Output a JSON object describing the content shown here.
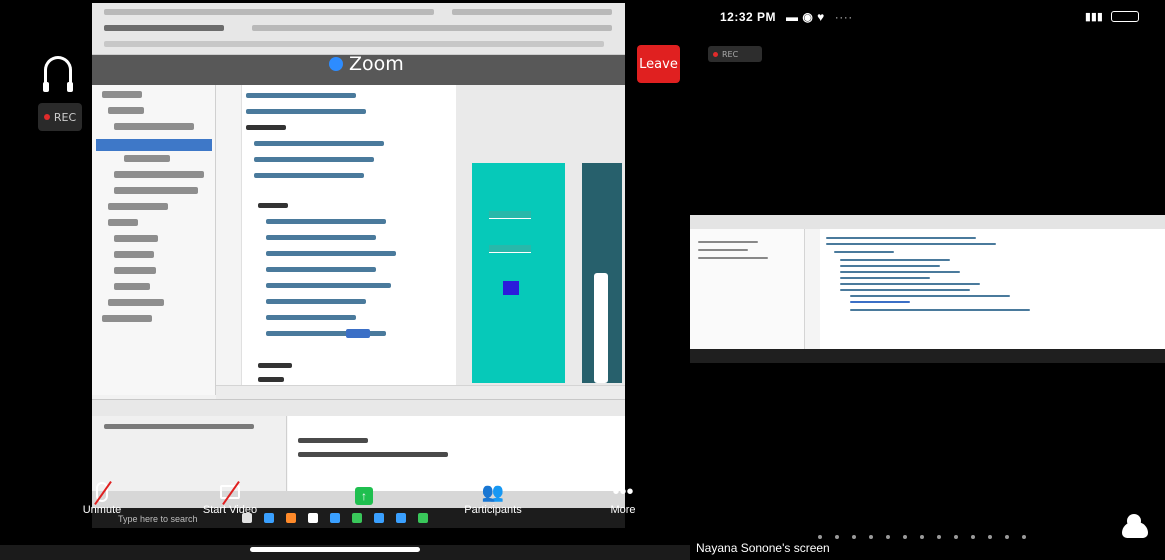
{
  "left_panel": {
    "recording_label": "REC",
    "leave_label": "Leave",
    "zoom_brand": "Zoom",
    "controls": {
      "unmute": "Unmute",
      "start_video": "Start Video",
      "participants": "Participants",
      "more": "More"
    },
    "taskbar_search": "Type here to search"
  },
  "right_panel": {
    "time": "12:32 PM",
    "recording_label": "REC",
    "screen_label": "Nayana Sonone's screen"
  },
  "colors": {
    "leave": "#e02020",
    "rec_dot": "#e02b2b",
    "phone_preview": "#06c9b9",
    "phone_button": "#2b1cdb",
    "share_button": "#1fbf4f"
  }
}
